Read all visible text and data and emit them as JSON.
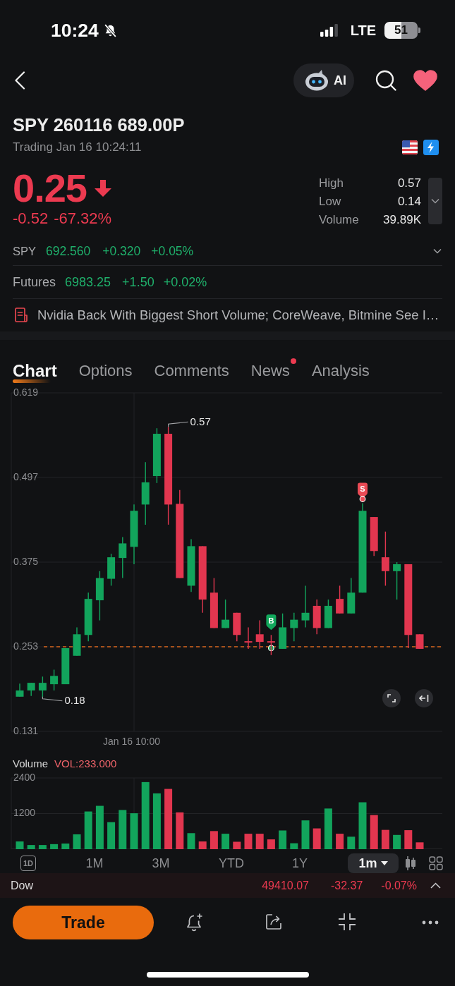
{
  "status_bar": {
    "time": "10:24",
    "network": "LTE",
    "battery": "51"
  },
  "nav": {
    "ai_label": "AI",
    "favorited": true
  },
  "header": {
    "title": "SPY 260116 689.00P",
    "status": "Trading Jan 16 10:24:11"
  },
  "quote": {
    "price": "0.25",
    "rising": false,
    "change": "-0.52",
    "change_percent": "-67.32%",
    "stats": [
      {
        "label": "High",
        "value": "0.57"
      },
      {
        "label": "Low",
        "value": "0.14"
      },
      {
        "label": "Volume",
        "value": "39.89K"
      }
    ]
  },
  "underlying": {
    "symbol": "SPY",
    "price": "692.560",
    "change": "+0.320",
    "change_percent": "+0.05%",
    "rising": true
  },
  "futures": {
    "label": "Futures",
    "price": "6983.25",
    "change": "+1.50",
    "change_percent": "+0.02%",
    "rising": true
  },
  "news": {
    "headline": "Nvidia Back With Biggest Short Volume; CoreWeave, Bitmine See I…"
  },
  "tabs": [
    {
      "label": "Chart",
      "selected": true,
      "unread": false
    },
    {
      "label": "Options",
      "selected": false,
      "unread": false
    },
    {
      "label": "Comments",
      "selected": false,
      "unread": false
    },
    {
      "label": "News",
      "selected": false,
      "unread": true
    },
    {
      "label": "Analysis",
      "selected": false,
      "unread": false
    }
  ],
  "price_chart": {
    "chart_data": {
      "type": "candlestick",
      "ohlc": [
        [
          0.181,
          0.2,
          0.181,
          0.19
        ],
        [
          0.19,
          0.201,
          0.182,
          0.201
        ],
        [
          0.19,
          0.21,
          0.18,
          0.201
        ],
        [
          0.199,
          0.22,
          0.19,
          0.211
        ],
        [
          0.199,
          0.251,
          0.199,
          0.251
        ],
        [
          0.24,
          0.281,
          0.24,
          0.271
        ],
        [
          0.27,
          0.331,
          0.261,
          0.322
        ],
        [
          0.32,
          0.362,
          0.291,
          0.352
        ],
        [
          0.351,
          0.387,
          0.341,
          0.382
        ],
        [
          0.381,
          0.411,
          0.352,
          0.402
        ],
        [
          0.397,
          0.458,
          0.372,
          0.449
        ],
        [
          0.458,
          0.519,
          0.429,
          0.49
        ],
        [
          0.499,
          0.568,
          0.489,
          0.56
        ],
        [
          0.56,
          0.57,
          0.429,
          0.458
        ],
        [
          0.459,
          0.479,
          0.352,
          0.352
        ],
        [
          0.341,
          0.408,
          0.332,
          0.398
        ],
        [
          0.398,
          0.398,
          0.302,
          0.321
        ],
        [
          0.331,
          0.352,
          0.28,
          0.28
        ],
        [
          0.28,
          0.321,
          0.28,
          0.292
        ],
        [
          0.302,
          0.302,
          0.261,
          0.27
        ],
        [
          0.261,
          0.281,
          0.25,
          0.259
        ],
        [
          0.271,
          0.291,
          0.25,
          0.26
        ],
        [
          0.261,
          0.27,
          0.241,
          0.259
        ],
        [
          0.25,
          0.301,
          0.25,
          0.281
        ],
        [
          0.28,
          0.302,
          0.261,
          0.292
        ],
        [
          0.291,
          0.341,
          0.281,
          0.302
        ],
        [
          0.312,
          0.321,
          0.271,
          0.28
        ],
        [
          0.28,
          0.321,
          0.28,
          0.312
        ],
        [
          0.322,
          0.341,
          0.301,
          0.301
        ],
        [
          0.301,
          0.352,
          0.301,
          0.331
        ],
        [
          0.331,
          0.46,
          0.331,
          0.449
        ],
        [
          0.44,
          0.44,
          0.384,
          0.391
        ],
        [
          0.382,
          0.419,
          0.341,
          0.362
        ],
        [
          0.362,
          0.375,
          0.321,
          0.372
        ],
        [
          0.372,
          0.372,
          0.251,
          0.27
        ],
        [
          0.271,
          0.271,
          0.25,
          0.25
        ]
      ],
      "ylim": [
        0.131,
        0.619
      ],
      "yticks": [
        0.619,
        0.497,
        0.375,
        0.253,
        0.131
      ],
      "grid": true,
      "ref_lines": [
        {
          "axis": "y",
          "value": 0.253
        }
      ],
      "annotations": [
        "0.57",
        "0.18"
      ]
    },
    "markers": [
      {
        "kind": "sell",
        "label": "S"
      },
      {
        "kind": "buy",
        "label": "B"
      }
    ],
    "time_label": "Jan 16 10:00"
  },
  "volume": {
    "label": "Volume",
    "reading": "VOL:233.000",
    "chart_data": {
      "type": "bar",
      "ylim": [
        0,
        2400
      ],
      "yticks": [
        2400,
        1200
      ],
      "grid": true,
      "values": [
        260,
        140,
        140,
        170,
        190,
        500,
        1270,
        1460,
        910,
        1320,
        1210,
        2260,
        1880,
        2030,
        1240,
        540,
        260,
        610,
        520,
        250,
        520,
        520,
        330,
        630,
        200,
        970,
        700,
        1370,
        520,
        420,
        1580,
        1150,
        650,
        480,
        640,
        230
      ]
    }
  },
  "periods": [
    {
      "label": "1D",
      "kind": "boxed",
      "selected": false
    },
    {
      "label": "1M",
      "kind": "text",
      "selected": false
    },
    {
      "label": "3M",
      "kind": "text",
      "selected": false
    },
    {
      "label": "YTD",
      "kind": "text",
      "selected": false
    },
    {
      "label": "1Y",
      "kind": "text",
      "selected": false
    },
    {
      "label": "1m",
      "kind": "dropdown",
      "selected": true
    }
  ],
  "index_bar": {
    "name": "Dow",
    "value": "49410.07",
    "change": "-32.37",
    "change_percent": "-0.07%",
    "rising": false,
    "expanded": false
  },
  "actions": {
    "trade_label": "Trade"
  }
}
